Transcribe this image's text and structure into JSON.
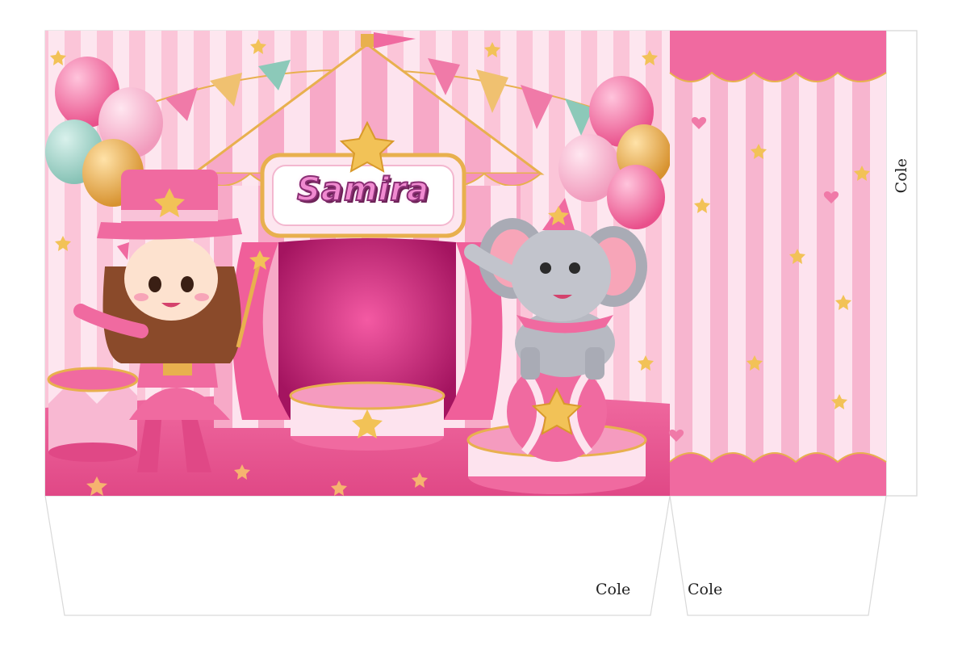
{
  "banner": {
    "name": "Samira"
  },
  "glue_labels": {
    "side_flap": "Cole",
    "bottom_left_flap": "Cole",
    "bottom_right_flap": "Cole"
  },
  "colors": {
    "primary_pink": "#f06aa0",
    "light_pink": "#fbd3e2",
    "gold": "#e6b04a",
    "outline": "#d9d9d9"
  }
}
